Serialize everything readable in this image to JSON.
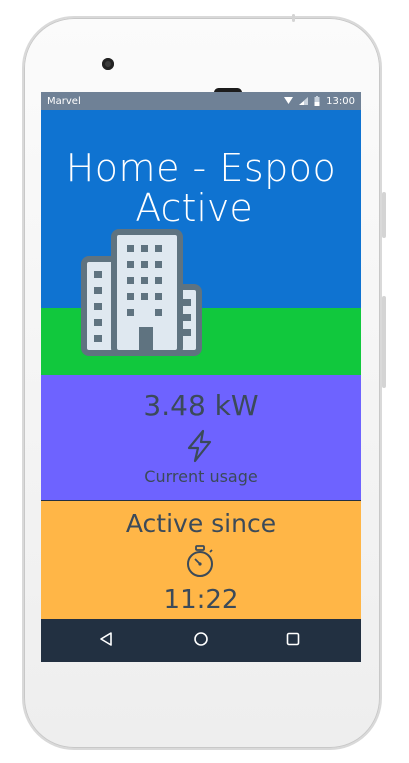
{
  "statusbar": {
    "carrier": "Marvel",
    "time": "13:00"
  },
  "hero": {
    "location": "Home - Espoo",
    "state": "Active",
    "icon": "building-icon"
  },
  "usage": {
    "value": "3.48 kW",
    "label": "Current usage",
    "icon": "lightning-icon"
  },
  "since": {
    "title": "Active since",
    "time": "11:22",
    "icon": "stopwatch-icon"
  },
  "nav": {
    "back": "back-icon",
    "home": "home-icon",
    "recents": "recents-icon"
  },
  "colors": {
    "hero_sky": "#0f73d1",
    "hero_grass": "#11c83d",
    "usage_bg": "#6e63ff",
    "since_bg": "#ffb647",
    "navbar": "#223041",
    "text_dark": "#3b4a59"
  }
}
